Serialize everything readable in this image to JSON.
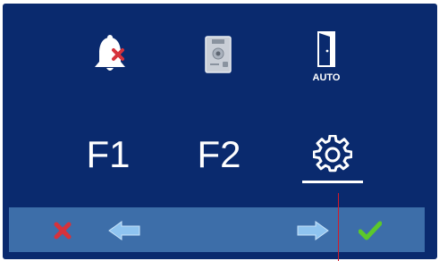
{
  "menu": {
    "row1": [
      {
        "icon": "bell-mute-icon"
      },
      {
        "icon": "door-panel-icon"
      },
      {
        "icon": "door-auto-icon",
        "label": "AUTO"
      }
    ],
    "row2": [
      {
        "label": "F1"
      },
      {
        "label": "F2"
      },
      {
        "icon": "gear-icon"
      }
    ]
  },
  "bottom_bar": {
    "buttons": [
      "cancel-x-icon",
      "arrow-left-icon",
      "arrow-right-icon",
      "confirm-check-icon"
    ]
  },
  "colors": {
    "background": "#0a2a6e",
    "bar": "#3d6ea9",
    "cancel": "#d6323b",
    "confirm": "#5cc82a",
    "arrow": "#8fc4f0"
  }
}
